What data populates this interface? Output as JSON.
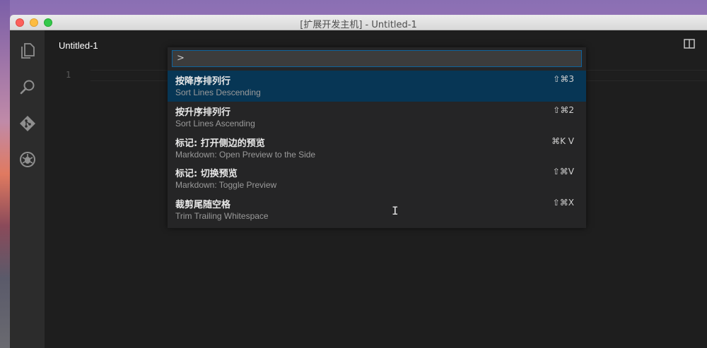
{
  "window": {
    "title": "[扩展开发主机] - Untitled-1"
  },
  "tab": {
    "title": "Untitled-1"
  },
  "editor": {
    "line_number": "1"
  },
  "palette": {
    "input_value": ">",
    "items": [
      {
        "label": "按降序排列行",
        "detail": "Sort Lines Descending",
        "keys": "⇧⌘3",
        "selected": true
      },
      {
        "label": "按升序排列行",
        "detail": "Sort Lines Ascending",
        "keys": "⇧⌘2",
        "selected": false
      },
      {
        "label": "标记: 打开侧边的预览",
        "detail": "Markdown: Open Preview to the Side",
        "keys": "⌘K V",
        "selected": false
      },
      {
        "label": "标记: 切换预览",
        "detail": "Markdown: Toggle Preview",
        "keys": "⇧⌘V",
        "selected": false
      },
      {
        "label": "裁剪尾随空格",
        "detail": "Trim Trailing Whitespace",
        "keys": "⇧⌘X",
        "selected": false
      }
    ]
  },
  "icons": {
    "activity": [
      "files-icon",
      "search-icon",
      "git-icon",
      "debug-icon"
    ],
    "editor_actions": [
      "split-editor-icon",
      "more-icon"
    ]
  },
  "colors": {
    "selection": "#073655",
    "focus_border": "#0e639c",
    "editor_bg": "#1e1e1e",
    "activitybar_bg": "#2c2c2c"
  }
}
